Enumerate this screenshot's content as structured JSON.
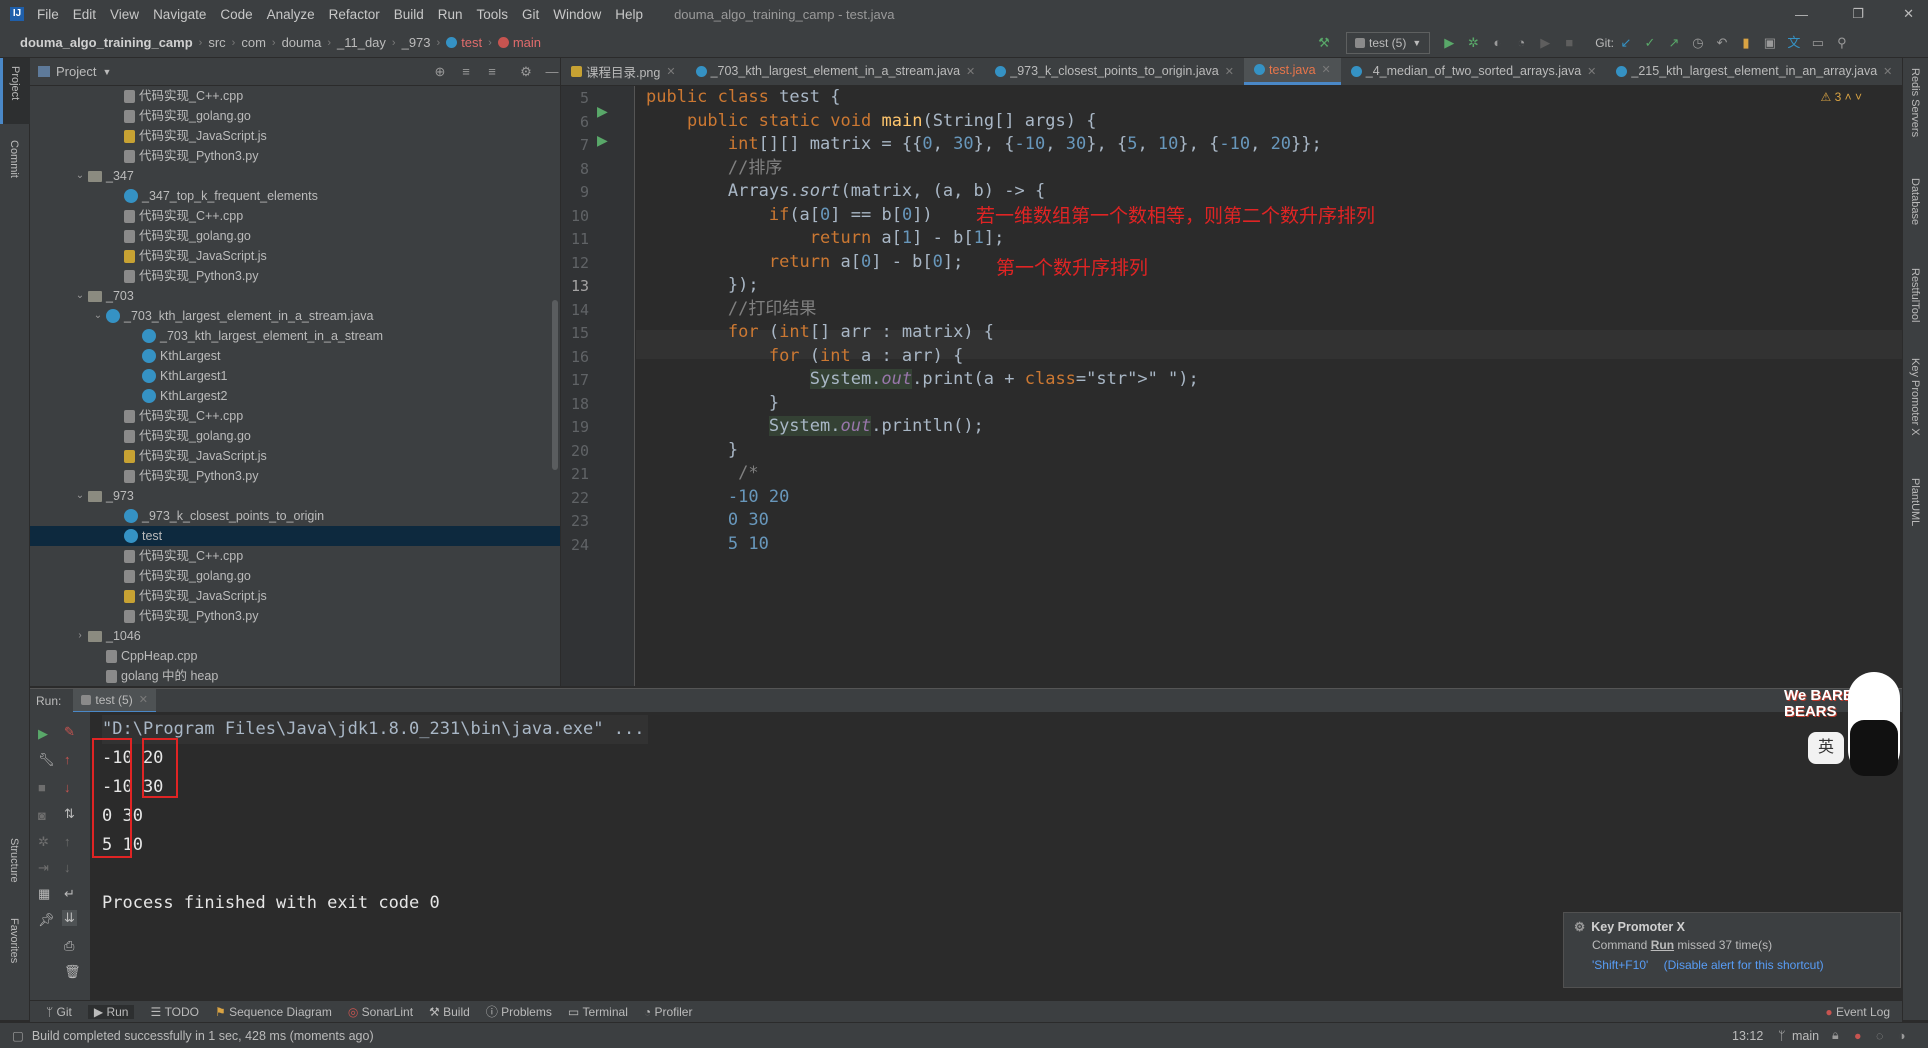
{
  "menubar": {
    "items": [
      "File",
      "Edit",
      "View",
      "Navigate",
      "Code",
      "Analyze",
      "Refactor",
      "Build",
      "Run",
      "Tools",
      "Git",
      "Window",
      "Help"
    ],
    "title": "douma_algo_training_camp - test.java"
  },
  "navbar": {
    "crumbs": [
      "douma_algo_training_camp",
      "src",
      "com",
      "douma",
      "_11_day",
      "_973",
      "test",
      "main"
    ],
    "run_config": "test (5)",
    "git_label": "Git:"
  },
  "project_panel": {
    "title": "Project",
    "tree": [
      {
        "label": "代码实现_C++.cpp",
        "icon": "file-icon",
        "indent": 4
      },
      {
        "label": "代码实现_golang.go",
        "icon": "file-icon",
        "indent": 4
      },
      {
        "label": "代码实现_JavaScript.js",
        "icon": "js-file-icon",
        "indent": 4
      },
      {
        "label": "代码实现_Python3.py",
        "icon": "file-icon",
        "indent": 4
      },
      {
        "label": "_347",
        "icon": "folder-icon",
        "indent": 2,
        "arrow": "v"
      },
      {
        "label": "_347_top_k_frequent_elements",
        "icon": "class-icon",
        "indent": 4
      },
      {
        "label": "代码实现_C++.cpp",
        "icon": "file-icon",
        "indent": 4
      },
      {
        "label": "代码实现_golang.go",
        "icon": "file-icon",
        "indent": 4
      },
      {
        "label": "代码实现_JavaScript.js",
        "icon": "js-file-icon",
        "indent": 4
      },
      {
        "label": "代码实现_Python3.py",
        "icon": "file-icon",
        "indent": 4
      },
      {
        "label": "_703",
        "icon": "folder-icon",
        "indent": 2,
        "arrow": "v"
      },
      {
        "label": "_703_kth_largest_element_in_a_stream.java",
        "icon": "class-icon",
        "indent": 3,
        "arrow": "v"
      },
      {
        "label": "_703_kth_largest_element_in_a_stream",
        "icon": "class-icon",
        "indent": 5
      },
      {
        "label": "KthLargest",
        "icon": "class-icon",
        "indent": 5
      },
      {
        "label": "KthLargest1",
        "icon": "class-icon",
        "indent": 5
      },
      {
        "label": "KthLargest2",
        "icon": "class-icon",
        "indent": 5
      },
      {
        "label": "代码实现_C++.cpp",
        "icon": "file-icon",
        "indent": 4
      },
      {
        "label": "代码实现_golang.go",
        "icon": "file-icon",
        "indent": 4
      },
      {
        "label": "代码实现_JavaScript.js",
        "icon": "js-file-icon",
        "indent": 4
      },
      {
        "label": "代码实现_Python3.py",
        "icon": "file-icon",
        "indent": 4
      },
      {
        "label": "_973",
        "icon": "folder-icon",
        "indent": 2,
        "arrow": "v"
      },
      {
        "label": "_973_k_closest_points_to_origin",
        "icon": "class-icon",
        "indent": 4
      },
      {
        "label": "test",
        "icon": "class-icon",
        "indent": 4,
        "selected": true
      },
      {
        "label": "代码实现_C++.cpp",
        "icon": "file-icon",
        "indent": 4
      },
      {
        "label": "代码实现_golang.go",
        "icon": "file-icon",
        "indent": 4
      },
      {
        "label": "代码实现_JavaScript.js",
        "icon": "js-file-icon",
        "indent": 4
      },
      {
        "label": "代码实现_Python3.py",
        "icon": "file-icon",
        "indent": 4
      },
      {
        "label": "_1046",
        "icon": "folder-icon",
        "indent": 2,
        "arrow": ">"
      },
      {
        "label": "CppHeap.cpp",
        "icon": "file-icon",
        "indent": 3
      },
      {
        "label": "golang 中的 heap",
        "icon": "file-icon",
        "indent": 3
      }
    ]
  },
  "tabs": [
    {
      "label": "课程目录.png",
      "active": false
    },
    {
      "label": "_703_kth_largest_element_in_a_stream.java",
      "active": false
    },
    {
      "label": "_973_k_closest_points_to_origin.java",
      "active": false
    },
    {
      "label": "test.java",
      "active": true
    },
    {
      "label": "_4_median_of_two_sorted_arrays.java",
      "active": false
    },
    {
      "label": "_215_kth_largest_element_in_an_array.java",
      "active": false
    }
  ],
  "editor": {
    "warnings": "3",
    "line_numbers": [
      "5",
      "6",
      "7",
      "8",
      "9",
      "10",
      "11",
      "12",
      "13",
      "14",
      "15",
      "16",
      "17",
      "18",
      "19",
      "20",
      "21",
      "22",
      "23",
      "24"
    ],
    "lines": [
      "public class test {",
      "    public static void main(String[] args) {",
      "        int[][] matrix = {{0, 30}, {-10, 30}, {5, 10}, {-10, 20}};",
      "        //排序",
      "        Arrays.sort(matrix, (a, b) -> {",
      "            if(a[0] == b[0])",
      "                return a[1] - b[1];",
      "            return a[0] - b[0];",
      "        });",
      "        //打印结果",
      "        for (int[] arr : matrix) {",
      "            for (int a : arr) {",
      "                System.out.print(a + \" \");",
      "            }",
      "            System.out.println();",
      "        }",
      "         /*",
      "        -10 20",
      "        0 30",
      "        5 10"
    ],
    "annotation_1": "若一维数组第一个数相等，则第二个数升序排列",
    "annotation_2": "第一个数升序排列"
  },
  "run": {
    "label": "Run:",
    "tab": "test (5)",
    "output": [
      "\"D:\\Program Files\\Java\\jdk1.8.0_231\\bin\\java.exe\" ...",
      "-10 20",
      "-10 30",
      "0 30",
      "5 10",
      "",
      "Process finished with exit code 0"
    ]
  },
  "notification": {
    "title": "Key Promoter X",
    "body_prefix": "Command",
    "body_command": "Run",
    "body_suffix": "missed 37 time(s)",
    "shortcut": "'Shift+F10'",
    "disable": "(Disable alert for this shortcut)"
  },
  "bottom_tools": [
    "Git",
    "Run",
    "TODO",
    "Sequence Diagram",
    "SonarLint",
    "Build",
    "Problems",
    "Terminal",
    "Profiler"
  ],
  "event_log": "Event Log",
  "status": {
    "message": "Build completed successfully in 1 sec, 428 ms (moments ago)",
    "position": "13:12",
    "branch": "main"
  },
  "left_strip": [
    "Project",
    "Commit",
    "Structure",
    "Favorites"
  ],
  "right_strip": [
    "Redis Servers",
    "Database",
    "RestfulTool",
    "Key Promoter X",
    "PlantUML"
  ],
  "mascot_text": "We BARE BEARS",
  "mascot_lang": "英"
}
